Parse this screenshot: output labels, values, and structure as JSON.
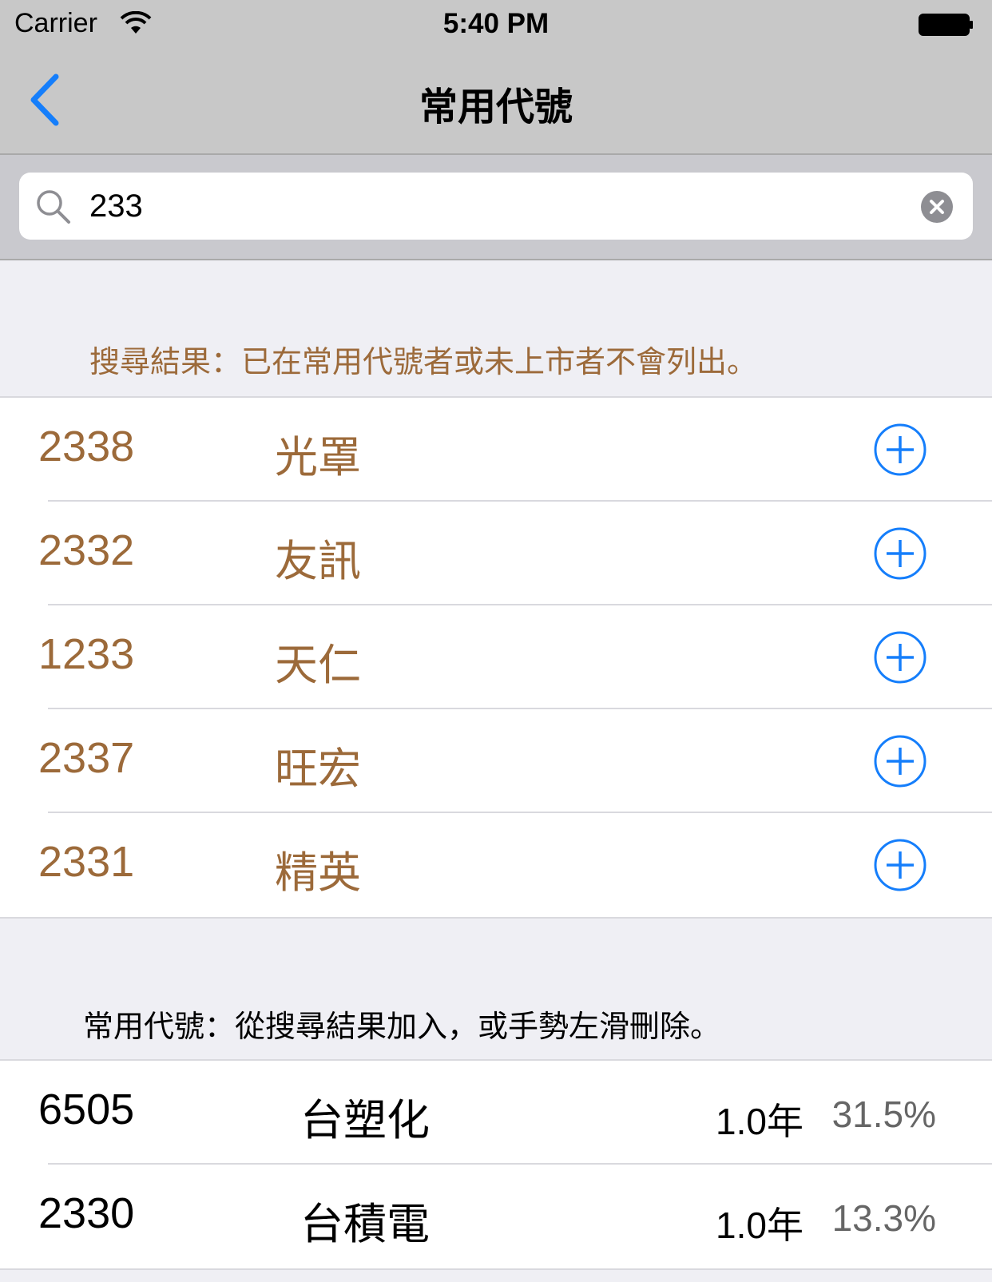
{
  "status_bar": {
    "carrier": "Carrier",
    "time": "5:40 PM"
  },
  "nav": {
    "title": "常用代號",
    "back_icon": "chevron-left-icon"
  },
  "search": {
    "value": "233",
    "placeholder": "",
    "icon": "search-icon",
    "clear_icon": "clear-icon"
  },
  "results_section": {
    "header": "搜尋結果：已在常用代號者或未上市者不會列出。",
    "items": [
      {
        "code": "2338",
        "name": "光罩"
      },
      {
        "code": "2332",
        "name": "友訊"
      },
      {
        "code": "1233",
        "name": "天仁"
      },
      {
        "code": "2337",
        "name": "旺宏"
      },
      {
        "code": "2331",
        "name": "精英"
      }
    ]
  },
  "favorites_section": {
    "header": "常用代號：從搜尋結果加入，或手勢左滑刪除。",
    "items": [
      {
        "code": "6505",
        "name": "台塑化",
        "period": "1.0年",
        "rate": "31.5%"
      },
      {
        "code": "2330",
        "name": "台積電",
        "period": "1.0年",
        "rate": "13.3%"
      }
    ]
  },
  "colors": {
    "accent_blue": "#157efb",
    "result_text": "#9c6a3a",
    "bar_gray": "#c8c8c8"
  }
}
